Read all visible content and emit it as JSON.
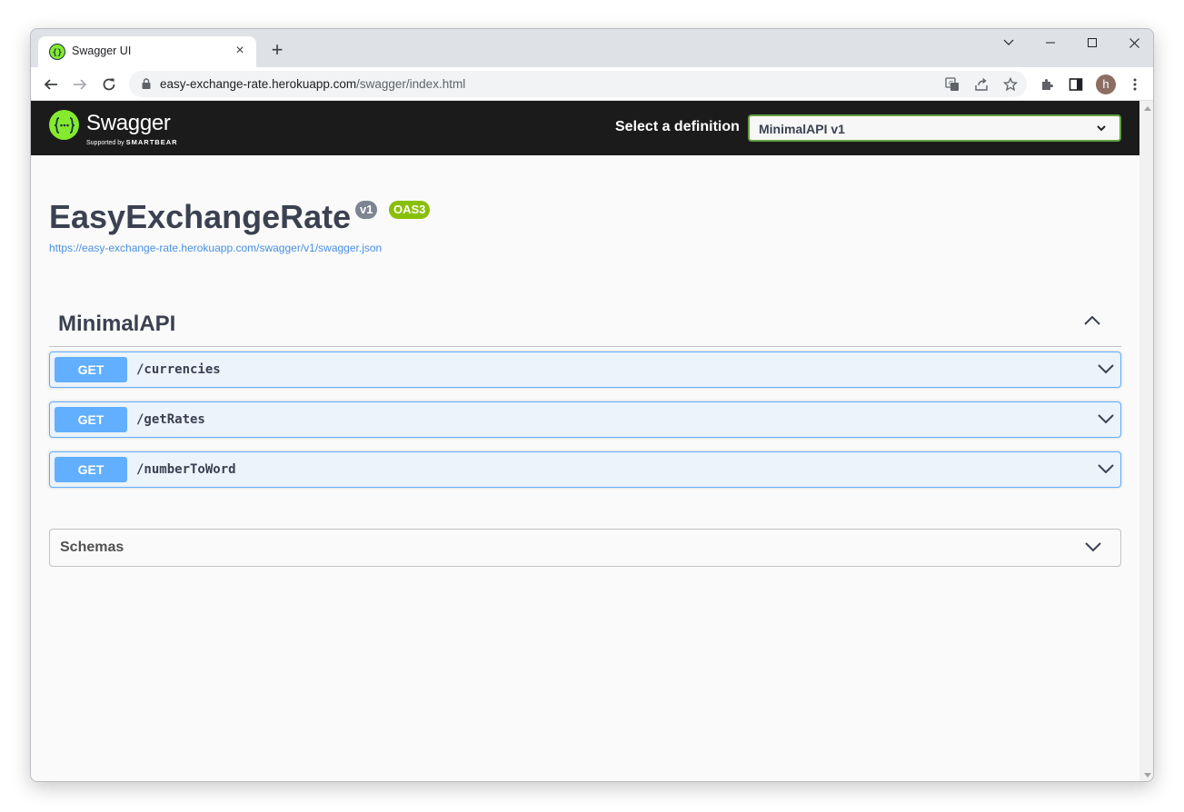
{
  "browser": {
    "tab_title": "Swagger UI",
    "tab_close": "×",
    "new_tab": "+",
    "url_host": "easy-exchange-rate.herokuapp.com",
    "url_path": "/swagger/index.html",
    "profile_initial": "h"
  },
  "swagger": {
    "logo_word": "Swagger",
    "logo_sub_prefix": "Supported by",
    "logo_sub_brand": "SMARTBEAR",
    "select_label": "Select a definition",
    "selected_definition": "MinimalAPI v1",
    "api_title": "EasyExchangeRate",
    "version_badge": "v1",
    "oas_badge": "OAS3",
    "spec_url": "https://easy-exchange-rate.herokuapp.com/swagger/v1/swagger.json",
    "tag": "MinimalAPI",
    "operations": [
      {
        "method": "GET",
        "path": "/currencies"
      },
      {
        "method": "GET",
        "path": "/getRates"
      },
      {
        "method": "GET",
        "path": "/numberToWord"
      }
    ],
    "schemas_label": "Schemas"
  },
  "colors": {
    "get_accent": "#61affe",
    "swagger_green": "#85ea2d",
    "topbar_bg": "#1b1b1b"
  }
}
